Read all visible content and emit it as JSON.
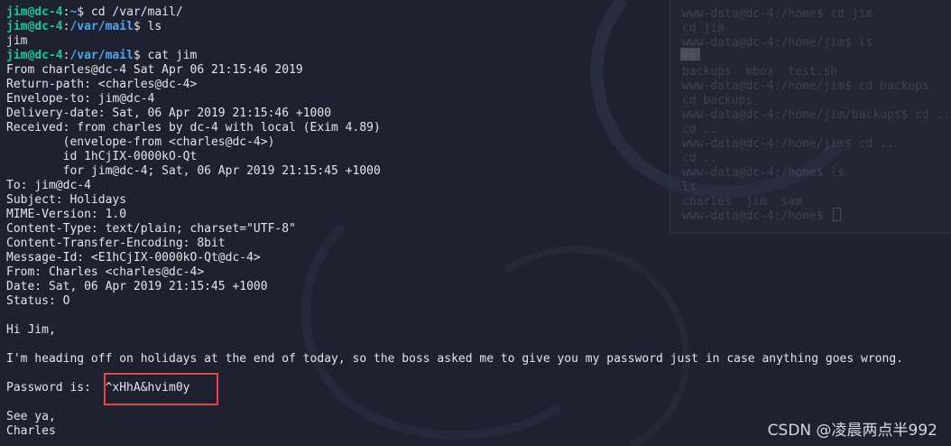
{
  "terminal": {
    "lines": [
      {
        "type": "prompt",
        "user": "jim@dc-4",
        "path": "~",
        "cmd": " cd /var/mail/"
      },
      {
        "type": "prompt",
        "user": "jim@dc-4",
        "path": "/var/mail",
        "cmd": " ls"
      },
      {
        "type": "text",
        "text": "jim"
      },
      {
        "type": "prompt",
        "user": "jim@dc-4",
        "path": "/var/mail",
        "cmd": " cat jim"
      },
      {
        "type": "text",
        "text": "From charles@dc-4 Sat Apr 06 21:15:46 2019"
      },
      {
        "type": "text",
        "text": "Return-path: <charles@dc-4>"
      },
      {
        "type": "text",
        "text": "Envelope-to: jim@dc-4"
      },
      {
        "type": "text",
        "text": "Delivery-date: Sat, 06 Apr 2019 21:15:46 +1000"
      },
      {
        "type": "text",
        "text": "Received: from charles by dc-4 with local (Exim 4.89)"
      },
      {
        "type": "text",
        "text": "        (envelope-from <charles@dc-4>)"
      },
      {
        "type": "text",
        "text": "        id 1hCjIX-0000kO-Qt"
      },
      {
        "type": "text",
        "text": "        for jim@dc-4; Sat, 06 Apr 2019 21:15:45 +1000"
      },
      {
        "type": "text",
        "text": "To: jim@dc-4"
      },
      {
        "type": "text",
        "text": "Subject: Holidays"
      },
      {
        "type": "text",
        "text": "MIME-Version: 1.0"
      },
      {
        "type": "text",
        "text": "Content-Type: text/plain; charset=\"UTF-8\""
      },
      {
        "type": "text",
        "text": "Content-Transfer-Encoding: 8bit"
      },
      {
        "type": "text",
        "text": "Message-Id: <E1hCjIX-0000kO-Qt@dc-4>"
      },
      {
        "type": "text",
        "text": "From: Charles <charles@dc-4>"
      },
      {
        "type": "text",
        "text": "Date: Sat, 06 Apr 2019 21:15:45 +1000"
      },
      {
        "type": "text",
        "text": "Status: O"
      },
      {
        "type": "text",
        "text": ""
      },
      {
        "type": "text",
        "text": "Hi Jim,"
      },
      {
        "type": "text",
        "text": ""
      },
      {
        "type": "text",
        "text": "I'm heading off on holidays at the end of today, so the boss asked me to give you my password just in case anything goes wrong."
      },
      {
        "type": "text",
        "text": ""
      },
      {
        "type": "text",
        "text": "Password is:  ^xHhA&hvim0y"
      },
      {
        "type": "text",
        "text": ""
      },
      {
        "type": "text",
        "text": "See ya,"
      },
      {
        "type": "text",
        "text": "Charles"
      }
    ]
  },
  "background_window": {
    "lines": [
      "www-data@dc-4:/home$ cd jim",
      "cd jim",
      "www-data@dc-4:/home/jim$ ls",
      "ls",
      "backups  mbox  test.sh",
      "www-data@dc-4:/home/jim$ cd backups",
      "cd backups",
      "www-data@dc-4:/home/jim/backups$ cd ..",
      "cd ..",
      "www-data@dc-4:/home/jim$ cd ..",
      "cd ..",
      "www-data@dc-4:/home$ ls",
      "ls",
      "charles  jim  sam",
      "www-data@dc-4:/home$ "
    ]
  },
  "watermark": "CSDN @凌晨两点半992",
  "colors": {
    "background": "#1f2130",
    "user_prompt": "#16c79a",
    "path_prompt": "#4ea6f3",
    "text": "#e3e5ea",
    "highlight_box": "#e04848"
  }
}
